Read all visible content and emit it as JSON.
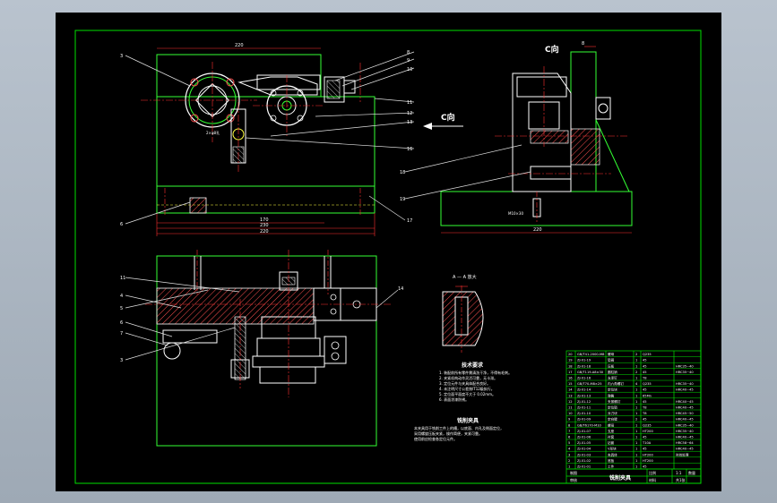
{
  "drawing": {
    "colors": {
      "background": "#000000",
      "frame": "#00e000",
      "outline": "#33ff33",
      "center": "#ff3030",
      "dim": "#ff3030",
      "part": "#ffffff",
      "hatch": "#ff5050",
      "leader": "#e0e0e0",
      "hidden": "#ffff40"
    },
    "view_label_c": "C向",
    "arrow_label_c": "C向",
    "section_label": "A — A 放大",
    "requirements_title": "技术要求",
    "requirements": [
      "1. 装配前所有零件需清洗干净，不得有毛刺。",
      "2. 夹紧机构动作灵活可靠，无卡滞。",
      "3. 定位元件与夹具体配合良好。",
      "4. 未注明尺寸公差按IT12级执行。",
      "5. 定位面平面度不大于 0.02mm。",
      "6. 表面涂漆防锈。"
    ],
    "notes_title": "铣削夹具",
    "notes": [
      "本夹具用于铣削工件上的槽，以底面、内孔及侧面定位，",
      "采用螺旋压板夹紧，操作简便，夹紧可靠。",
      "使用前应检查各定位元件。"
    ],
    "dims": {
      "top_width": "220",
      "bottom_1": "170",
      "bottom_2": "230",
      "bottom_3": "220",
      "right_width": "220",
      "right_top": "8",
      "hole_note": "2×φ8孔",
      "bolt_note": "M10×30"
    },
    "balloons_left": [
      "3",
      "5",
      "6"
    ],
    "balloons_right": [
      "8",
      "9",
      "10",
      "11",
      "12",
      "13",
      "15",
      "16",
      "17"
    ],
    "balloons_mid": [
      "18",
      "19"
    ],
    "balloons_lower": [
      "11",
      "4",
      "5",
      "6",
      "7",
      "3",
      "14"
    ],
    "title_block": {
      "title": "铣削夹具",
      "scale_label": "比例",
      "scale": "1:1",
      "sheet": "共1张",
      "drawn_label": "制图",
      "checked_label": "审核",
      "qty_label": "数量",
      "material_label": "材料",
      "rows": [
        [
          "20",
          "GB/T41-2000-M8",
          "螺母",
          "2",
          "Q235",
          ""
        ],
        [
          "19",
          "ZJ-01-19",
          "垫圈",
          "1",
          "45",
          ""
        ],
        [
          "18",
          "ZJ-01-18",
          "压板",
          "1",
          "45",
          "HRC35~40"
        ],
        [
          "17",
          "GB/T119-A8×30",
          "圆柱销",
          "2",
          "45",
          "HRC35~40"
        ],
        [
          "16",
          "ZJ-01-16",
          "支承钉",
          "1",
          "T8",
          ""
        ],
        [
          "15",
          "GB/T70-M8×25",
          "内六角螺钉",
          "4",
          "Q235",
          "HRC35~40"
        ],
        [
          "14",
          "ZJ-01-14",
          "定位块",
          "1",
          "45",
          "HRC40~45"
        ],
        [
          "13",
          "ZJ-01-13",
          "弹簧",
          "1",
          "65Mn",
          ""
        ],
        [
          "12",
          "ZJ-01-12",
          "夹紧螺钉",
          "1",
          "45",
          "HRC40~45"
        ],
        [
          "11",
          "ZJ-01-11",
          "定位销",
          "1",
          "T8",
          "HRC40~45"
        ],
        [
          "10",
          "ZJ-01-10",
          "对刀块",
          "1",
          "T8",
          "HRC45~50"
        ],
        [
          "9",
          "ZJ-01-09",
          "定向键",
          "2",
          "45",
          "HRC40~45"
        ],
        [
          "8",
          "GB/T6170-M10",
          "螺母",
          "1",
          "Q235",
          "HRC35~40"
        ],
        [
          "7",
          "ZJ-01-07",
          "支座",
          "1",
          "HT200",
          "HRC35~40"
        ],
        [
          "6",
          "ZJ-01-06",
          "衬套",
          "1",
          "45",
          "HRC40~45"
        ],
        [
          "5",
          "ZJ-01-05",
          "钻套",
          "1",
          "T10A",
          "HRC58~64"
        ],
        [
          "4",
          "ZJ-01-04",
          "V形块",
          "1",
          "45",
          "HRC40~45"
        ],
        [
          "3",
          "ZJ-01-03",
          "夹具体",
          "1",
          "HT200",
          "时效处理"
        ],
        [
          "2",
          "ZJ-01-02",
          "底板",
          "1",
          "HT200",
          ""
        ],
        [
          "1",
          "ZJ-01-01",
          "工件",
          "1",
          "45",
          ""
        ]
      ]
    }
  }
}
